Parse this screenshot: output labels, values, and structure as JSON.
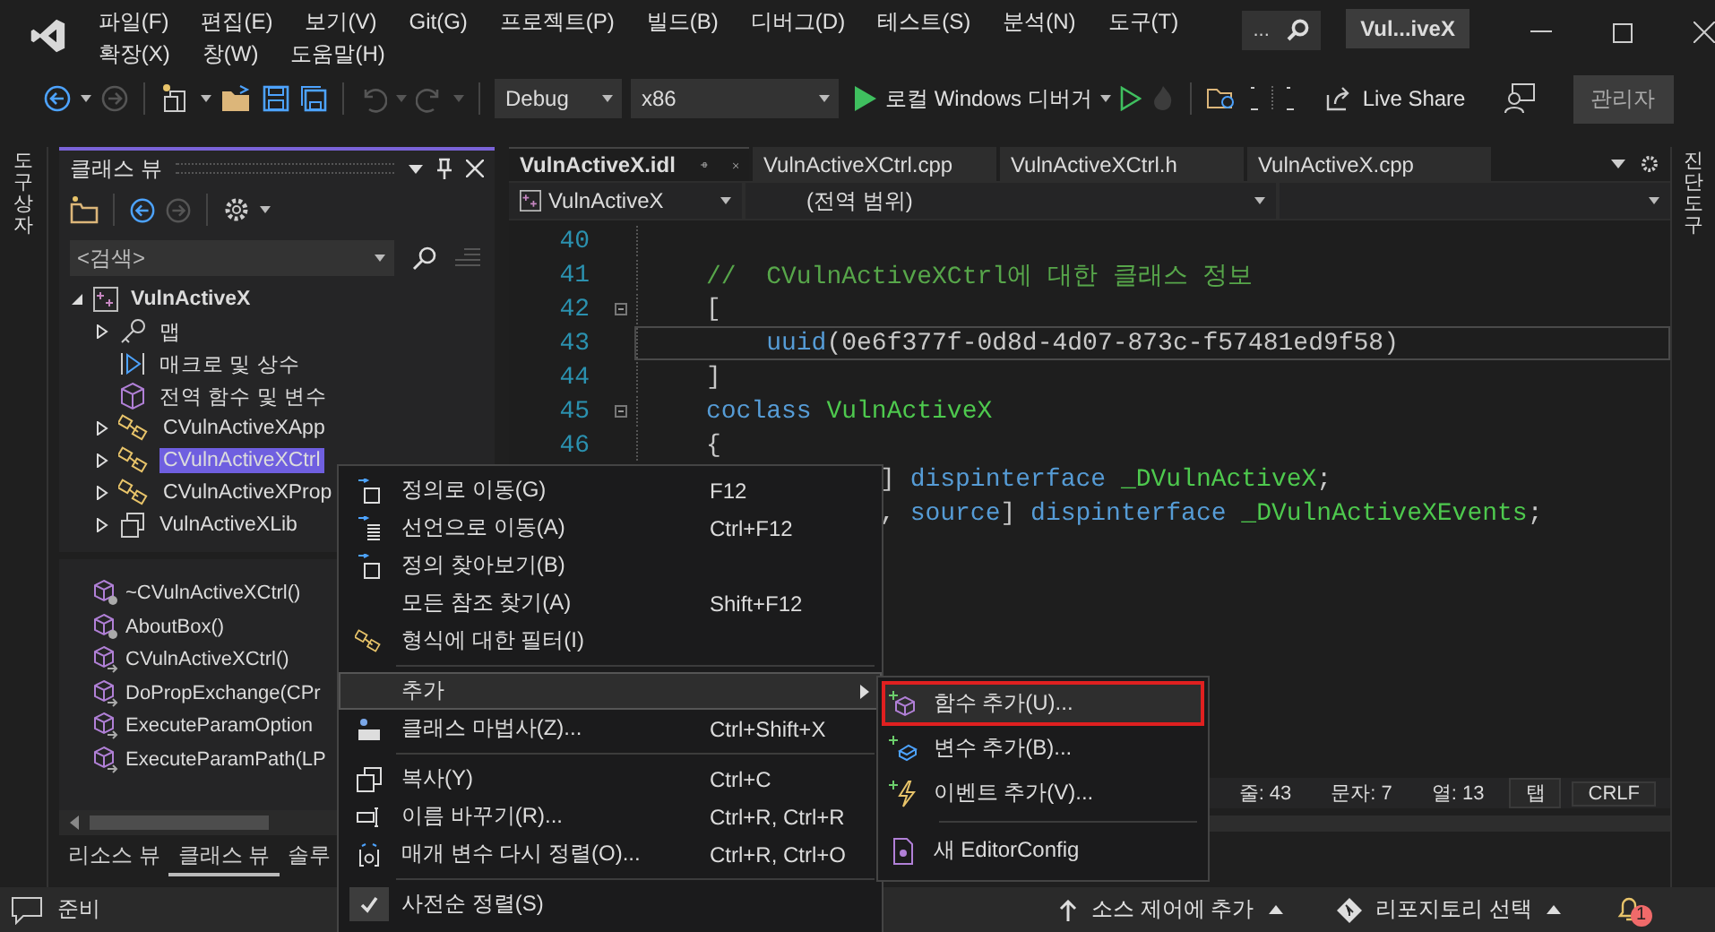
{
  "window": {
    "title": "Vul...iveX",
    "search": "..."
  },
  "menu": [
    "파일(F)",
    "편집(E)",
    "보기(V)",
    "Git(G)",
    "프로젝트(P)",
    "빌드(B)",
    "디버그(D)",
    "테스트(S)",
    "분석(N)",
    "도구(T)",
    "확장(X)",
    "창(W)",
    "도움말(H)"
  ],
  "toolbar": {
    "configuration": "Debug",
    "platform": "x86",
    "debugger": "로컬 Windows 디버거",
    "live_share": "Live Share",
    "admin": "관리자"
  },
  "left_strip": "도구 상자",
  "right_strip": "진단 도구",
  "class_view": {
    "title": "클래스 뷰",
    "search_placeholder": "<검색>",
    "tree": [
      {
        "label": "VulnActiveX",
        "kind": "group",
        "expanded": true,
        "selected": false,
        "children": [
          {
            "label": "맵",
            "kind": "group",
            "expanded": false,
            "selected": false
          },
          {
            "label": "매크로 및 상수",
            "kind": "leaf",
            "selected": false
          },
          {
            "label": "전역 함수 및 변수",
            "kind": "leaf",
            "selected": false
          },
          {
            "label": "CVulnActiveXApp",
            "kind": "group",
            "expanded": false,
            "selected": false
          },
          {
            "label": "CVulnActiveXCtrl",
            "kind": "group",
            "expanded": false,
            "selected": true
          },
          {
            "label": "CVulnActiveXProp",
            "kind": "group",
            "expanded": false,
            "selected": false
          },
          {
            "label": "VulnActiveXLib",
            "kind": "group",
            "expanded": false,
            "selected": false
          }
        ]
      }
    ],
    "members": [
      "~CVulnActiveXCtrl()",
      "AboutBox()",
      "CVulnActiveXCtrl()",
      "DoPropExchange(CPr",
      "ExecuteParamOption",
      "ExecuteParamPath(LP"
    ],
    "tabs": [
      {
        "label": "리소스 뷰",
        "selected": false
      },
      {
        "label": "클래스 뷰",
        "selected": true
      },
      {
        "label": "솔루",
        "selected": false
      }
    ]
  },
  "editor": {
    "tabs": [
      {
        "label": "VulnActiveX.idl",
        "selected": true
      },
      {
        "label": "VulnActiveXCtrl.cpp",
        "selected": false
      },
      {
        "label": "VulnActiveXCtrl.h",
        "selected": false
      },
      {
        "label": "VulnActiveX.cpp",
        "selected": false
      }
    ],
    "scope_project": "VulnActiveX",
    "scope": "(전역 범위)",
    "lines": [
      {
        "number": "40",
        "fold": false,
        "current": false
      },
      {
        "number": "41",
        "fold": false,
        "current": false,
        "tokens": [
          {
            "kind": "comment",
            "text": "//  CVulnActiveXCtrl에 대한 클래스 정보"
          }
        ]
      },
      {
        "number": "42",
        "fold": true,
        "current": false,
        "tokens": [
          {
            "kind": "plain",
            "text": "["
          }
        ]
      },
      {
        "number": "43",
        "fold": false,
        "current": true,
        "tokens": [
          {
            "kind": "keyword",
            "text": "    uuid"
          },
          {
            "kind": "plain",
            "text": "(0e6f377f-0d8d-4d07-873c-f57481ed9f58)"
          }
        ]
      },
      {
        "number": "44",
        "fold": false,
        "current": false,
        "tokens": [
          {
            "kind": "plain",
            "text": "]"
          }
        ]
      },
      {
        "number": "45",
        "fold": true,
        "current": false,
        "tokens": [
          {
            "kind": "keyword",
            "text": "coclass "
          },
          {
            "kind": "type",
            "text": "VulnActiveX"
          }
        ]
      },
      {
        "number": "46",
        "fold": false,
        "current": false,
        "tokens": [
          {
            "kind": "plain",
            "text": "{"
          }
        ]
      }
    ],
    "partial_lines": [
      [
        {
          "kind": "plain",
          "text": "] "
        },
        {
          "kind": "keyword",
          "text": "dispinterface "
        },
        {
          "kind": "type",
          "text": "_DVulnActiveX"
        },
        {
          "kind": "plain",
          "text": ";"
        }
      ],
      [
        {
          "kind": "plain",
          "text": ", "
        },
        {
          "kind": "keyword",
          "text": "source"
        },
        {
          "kind": "plain",
          "text": "] "
        },
        {
          "kind": "keyword",
          "text": "dispinterface "
        },
        {
          "kind": "type",
          "text": "_DVulnActiveXEvents"
        },
        {
          "kind": "plain",
          "text": ";"
        }
      ]
    ],
    "status": [
      "줄: 43",
      "문자: 7",
      "열: 13",
      "탭",
      "CRLF"
    ]
  },
  "context_menu": [
    {
      "kind": "item",
      "label": "정의로 이동(G)",
      "shortcut": "F12",
      "checked": false,
      "selected": false
    },
    {
      "kind": "item",
      "label": "선언으로 이동(A)",
      "shortcut": "Ctrl+F12",
      "checked": false,
      "selected": false
    },
    {
      "kind": "item",
      "label": "정의 찾아보기(B)",
      "checked": false,
      "selected": false
    },
    {
      "kind": "item",
      "label": "모든 참조 찾기(A)",
      "shortcut": "Shift+F12",
      "checked": false,
      "selected": false
    },
    {
      "kind": "item",
      "label": "형식에 대한 필터(I)",
      "checked": false,
      "selected": false
    },
    {
      "kind": "separator"
    },
    {
      "kind": "submenu",
      "label": "추가",
      "checked": false,
      "selected": true
    },
    {
      "kind": "item",
      "label": "클래스 마법사(Z)...",
      "shortcut": "Ctrl+Shift+X",
      "checked": false,
      "selected": false
    },
    {
      "kind": "separator"
    },
    {
      "kind": "item",
      "label": "복사(Y)",
      "shortcut": "Ctrl+C",
      "checked": false,
      "selected": false
    },
    {
      "kind": "item",
      "label": "이름 바꾸기(R)...",
      "shortcut": "Ctrl+R, Ctrl+R",
      "checked": false,
      "selected": false
    },
    {
      "kind": "item",
      "label": "매개 변수 다시 정렬(O)...",
      "shortcut": "Ctrl+R, Ctrl+O",
      "checked": false,
      "selected": false
    },
    {
      "kind": "separator"
    },
    {
      "kind": "item",
      "label": "사전순 정렬(S)",
      "checked": true,
      "selected": false
    }
  ],
  "submenu": [
    {
      "kind": "item",
      "label": "함수 추가(U)...",
      "selected": true,
      "marked": true
    },
    {
      "kind": "item",
      "label": "변수 추가(B)...",
      "selected": false,
      "marked": false
    },
    {
      "kind": "item",
      "label": "이벤트 추가(V)...",
      "selected": false,
      "marked": false
    },
    {
      "kind": "separator"
    },
    {
      "kind": "item",
      "label": "새 EditorConfig",
      "selected": false,
      "marked": false
    }
  ],
  "status_bar": {
    "state": "준비",
    "source_control": "소스 제어에 추가",
    "repository": "리포지토리 선택",
    "notifications": "1"
  }
}
